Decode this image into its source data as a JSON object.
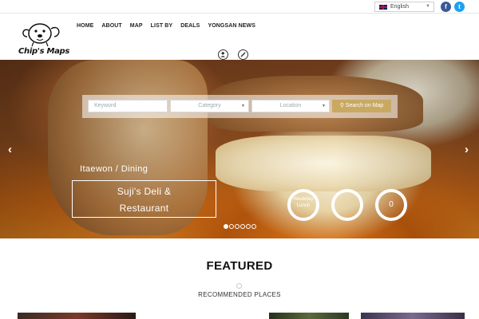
{
  "topbar": {
    "language": "English",
    "social": [
      {
        "name": "facebook",
        "glyph": "f",
        "color": "#3b5998"
      },
      {
        "name": "twitter",
        "glyph": "t",
        "color": "#1da1f2"
      }
    ]
  },
  "header": {
    "logo_text": "Chip's Maps",
    "nav": [
      "HOME",
      "ABOUT",
      "MAP",
      "LIST BY",
      "DEALS",
      "YONGSAN NEWS"
    ],
    "icons": [
      "user-icon",
      "edit-icon"
    ]
  },
  "hero": {
    "search": {
      "keyword_placeholder": "Keyword",
      "category_placeholder": "Category",
      "location_placeholder": "Location",
      "button_label": "Search on Map"
    },
    "place_category": "Itaewon / Dining",
    "place_name_line1": "Suji's Deli &",
    "place_name_line2": "Restaurant",
    "stats": {
      "s1_line1": "Weekday",
      "s1_line2": "Lunch",
      "s2": "",
      "s3": "0"
    },
    "slides_total": 6,
    "slide_active": 1,
    "prev_arrow": "‹",
    "next_arrow": "›"
  },
  "featured": {
    "title": "FEATURED",
    "subtitle": "RECOMMENDED PLACES"
  },
  "colors": {
    "accent": "#c9a961",
    "facebook": "#3b5998",
    "twitter": "#1da1f2"
  }
}
